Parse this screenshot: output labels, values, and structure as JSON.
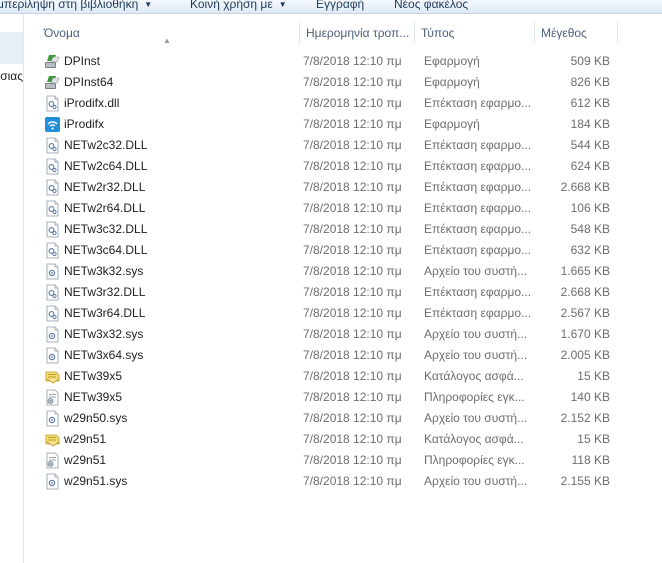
{
  "toolbar": {
    "items": [
      {
        "label": "μπερίληψη στη βιβλιοθήκη",
        "has_menu": true
      },
      {
        "label": "Κοινή χρήση με",
        "has_menu": true
      },
      {
        "label": "Εγγραφή",
        "has_menu": false
      },
      {
        "label": "Νέος φακέλος",
        "has_menu": false
      }
    ],
    "menu_arrow": "▼"
  },
  "nav": {
    "partial_label": "σιας"
  },
  "columns": {
    "name": "Όνομα",
    "date": "Ημερομηνία τροπ...",
    "type": "Τύπος",
    "size": "Μέγεθος",
    "sort_indicator": "▲"
  },
  "files": [
    {
      "icon": "installer-icon",
      "name": "DPInst",
      "date": "7/8/2018 12:10 πμ",
      "type": "Εφαρμογή",
      "size": "509 KB"
    },
    {
      "icon": "installer-icon",
      "name": "DPInst64",
      "date": "7/8/2018 12:10 πμ",
      "type": "Εφαρμογή",
      "size": "826 KB"
    },
    {
      "icon": "dll-file-icon",
      "name": "iProdifx.dll",
      "date": "7/8/2018 12:10 πμ",
      "type": "Επέκταση εφαρμο...",
      "size": "612 KB"
    },
    {
      "icon": "wifi-app-icon",
      "name": "iProdifx",
      "date": "7/8/2018 12:10 πμ",
      "type": "Εφαρμογή",
      "size": "184 KB"
    },
    {
      "icon": "dll-file-icon",
      "name": "NETw2c32.DLL",
      "date": "7/8/2018 12:10 πμ",
      "type": "Επέκταση εφαρμο...",
      "size": "544 KB"
    },
    {
      "icon": "dll-file-icon",
      "name": "NETw2c64.DLL",
      "date": "7/8/2018 12:10 πμ",
      "type": "Επέκταση εφαρμο...",
      "size": "624 KB"
    },
    {
      "icon": "dll-file-icon",
      "name": "NETw2r32.DLL",
      "date": "7/8/2018 12:10 πμ",
      "type": "Επέκταση εφαρμο...",
      "size": "2.668 KB"
    },
    {
      "icon": "dll-file-icon",
      "name": "NETw2r64.DLL",
      "date": "7/8/2018 12:10 πμ",
      "type": "Επέκταση εφαρμο...",
      "size": "106 KB"
    },
    {
      "icon": "dll-file-icon",
      "name": "NETw3c32.DLL",
      "date": "7/8/2018 12:10 πμ",
      "type": "Επέκταση εφαρμο...",
      "size": "548 KB"
    },
    {
      "icon": "dll-file-icon",
      "name": "NETw3c64.DLL",
      "date": "7/8/2018 12:10 πμ",
      "type": "Επέκταση εφαρμο...",
      "size": "632 KB"
    },
    {
      "icon": "sys-file-icon",
      "name": "NETw3k32.sys",
      "date": "7/8/2018 12:10 πμ",
      "type": "Αρχείο του συστή...",
      "size": "1.665 KB"
    },
    {
      "icon": "dll-file-icon",
      "name": "NETw3r32.DLL",
      "date": "7/8/2018 12:10 πμ",
      "type": "Επέκταση εφαρμο...",
      "size": "2.668 KB"
    },
    {
      "icon": "dll-file-icon",
      "name": "NETw3r64.DLL",
      "date": "7/8/2018 12:10 πμ",
      "type": "Επέκταση εφαρμο...",
      "size": "2.567 KB"
    },
    {
      "icon": "sys-file-icon",
      "name": "NETw3x32.sys",
      "date": "7/8/2018 12:10 πμ",
      "type": "Αρχείο του συστή...",
      "size": "1.670 KB"
    },
    {
      "icon": "sys-file-icon",
      "name": "NETw3x64.sys",
      "date": "7/8/2018 12:10 πμ",
      "type": "Αρχείο του συστή...",
      "size": "2.005 KB"
    },
    {
      "icon": "catalog-file-icon",
      "name": "NETw39x5",
      "date": "7/8/2018 12:10 πμ",
      "type": "Κατάλογος ασφά...",
      "size": "15 KB"
    },
    {
      "icon": "setup-info-icon",
      "name": "NETw39x5",
      "date": "7/8/2018 12:10 πμ",
      "type": "Πληροφορίες εγκ...",
      "size": "140 KB"
    },
    {
      "icon": "sys-file-icon",
      "name": "w29n50.sys",
      "date": "7/8/2018 12:10 πμ",
      "type": "Αρχείο του συστή...",
      "size": "2.152 KB"
    },
    {
      "icon": "catalog-file-icon",
      "name": "w29n51",
      "date": "7/8/2018 12:10 πμ",
      "type": "Κατάλογος ασφά...",
      "size": "15 KB"
    },
    {
      "icon": "setup-info-icon",
      "name": "w29n51",
      "date": "7/8/2018 12:10 πμ",
      "type": "Πληροφορίες εγκ...",
      "size": "118 KB"
    },
    {
      "icon": "sys-file-icon",
      "name": "w29n51.sys",
      "date": "7/8/2018 12:10 πμ",
      "type": "Αρχείο του συστή...",
      "size": "2.155 KB"
    }
  ]
}
